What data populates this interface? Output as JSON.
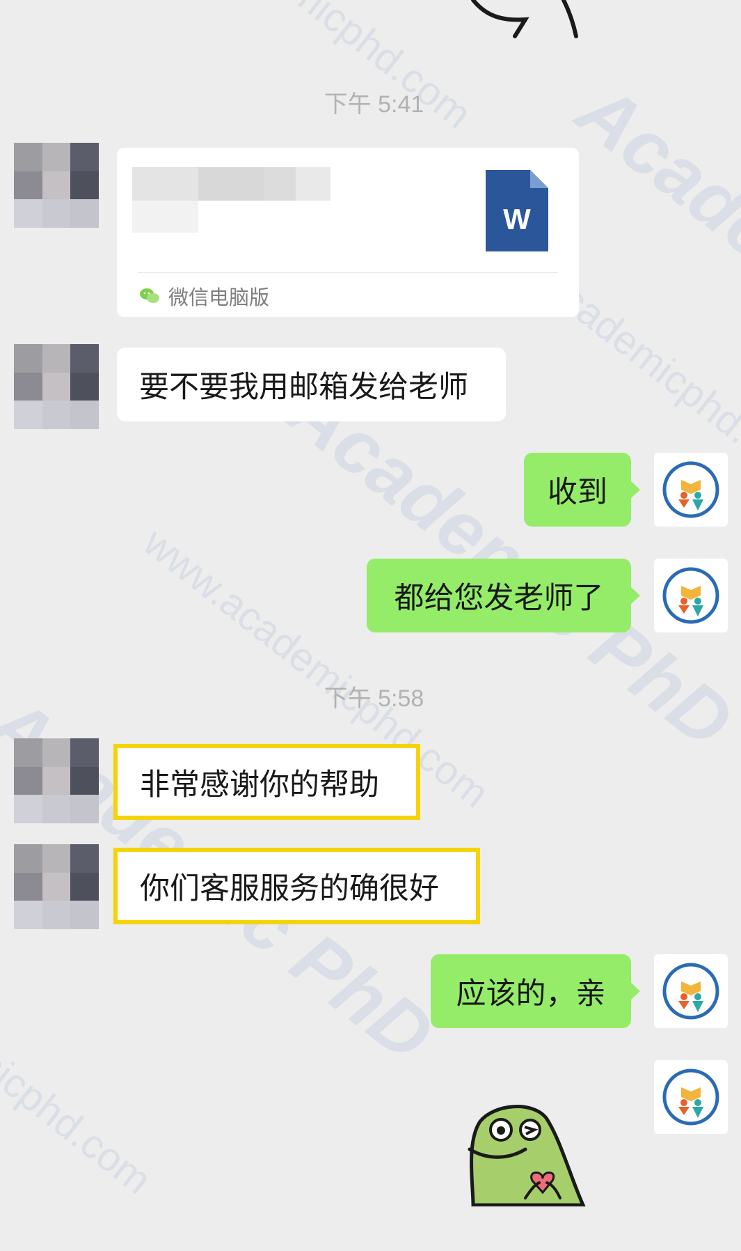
{
  "chat": {
    "timestamps": [
      "下午 5:41",
      "下午 5:58"
    ],
    "file_message": {
      "source_label": "微信电脑版",
      "file_type_letter": "W",
      "file_icon_color": "#2b579a"
    },
    "messages": [
      {
        "side": "in",
        "text": "要不要我用邮箱发给老师",
        "highlighted": false
      },
      {
        "side": "out",
        "text": "收到",
        "highlighted": false
      },
      {
        "side": "out",
        "text": "都给您发老师了",
        "highlighted": false
      },
      {
        "side": "in",
        "text": "非常感谢你的帮助",
        "highlighted": true
      },
      {
        "side": "in",
        "text": "你们客服服务的确很好",
        "highlighted": true
      },
      {
        "side": "out",
        "text": "应该的，亲",
        "highlighted": false
      }
    ]
  },
  "colors": {
    "background": "#ededed",
    "incoming_bubble": "#ffffff",
    "outgoing_bubble": "#95ec69",
    "highlight_border": "#f5d309",
    "timestamp_text": "#b2b2b2",
    "sticker_green": "#a6cf6b"
  },
  "watermark": {
    "logo_text": "Academic PhD",
    "url_text": "www.academicphd.com"
  }
}
